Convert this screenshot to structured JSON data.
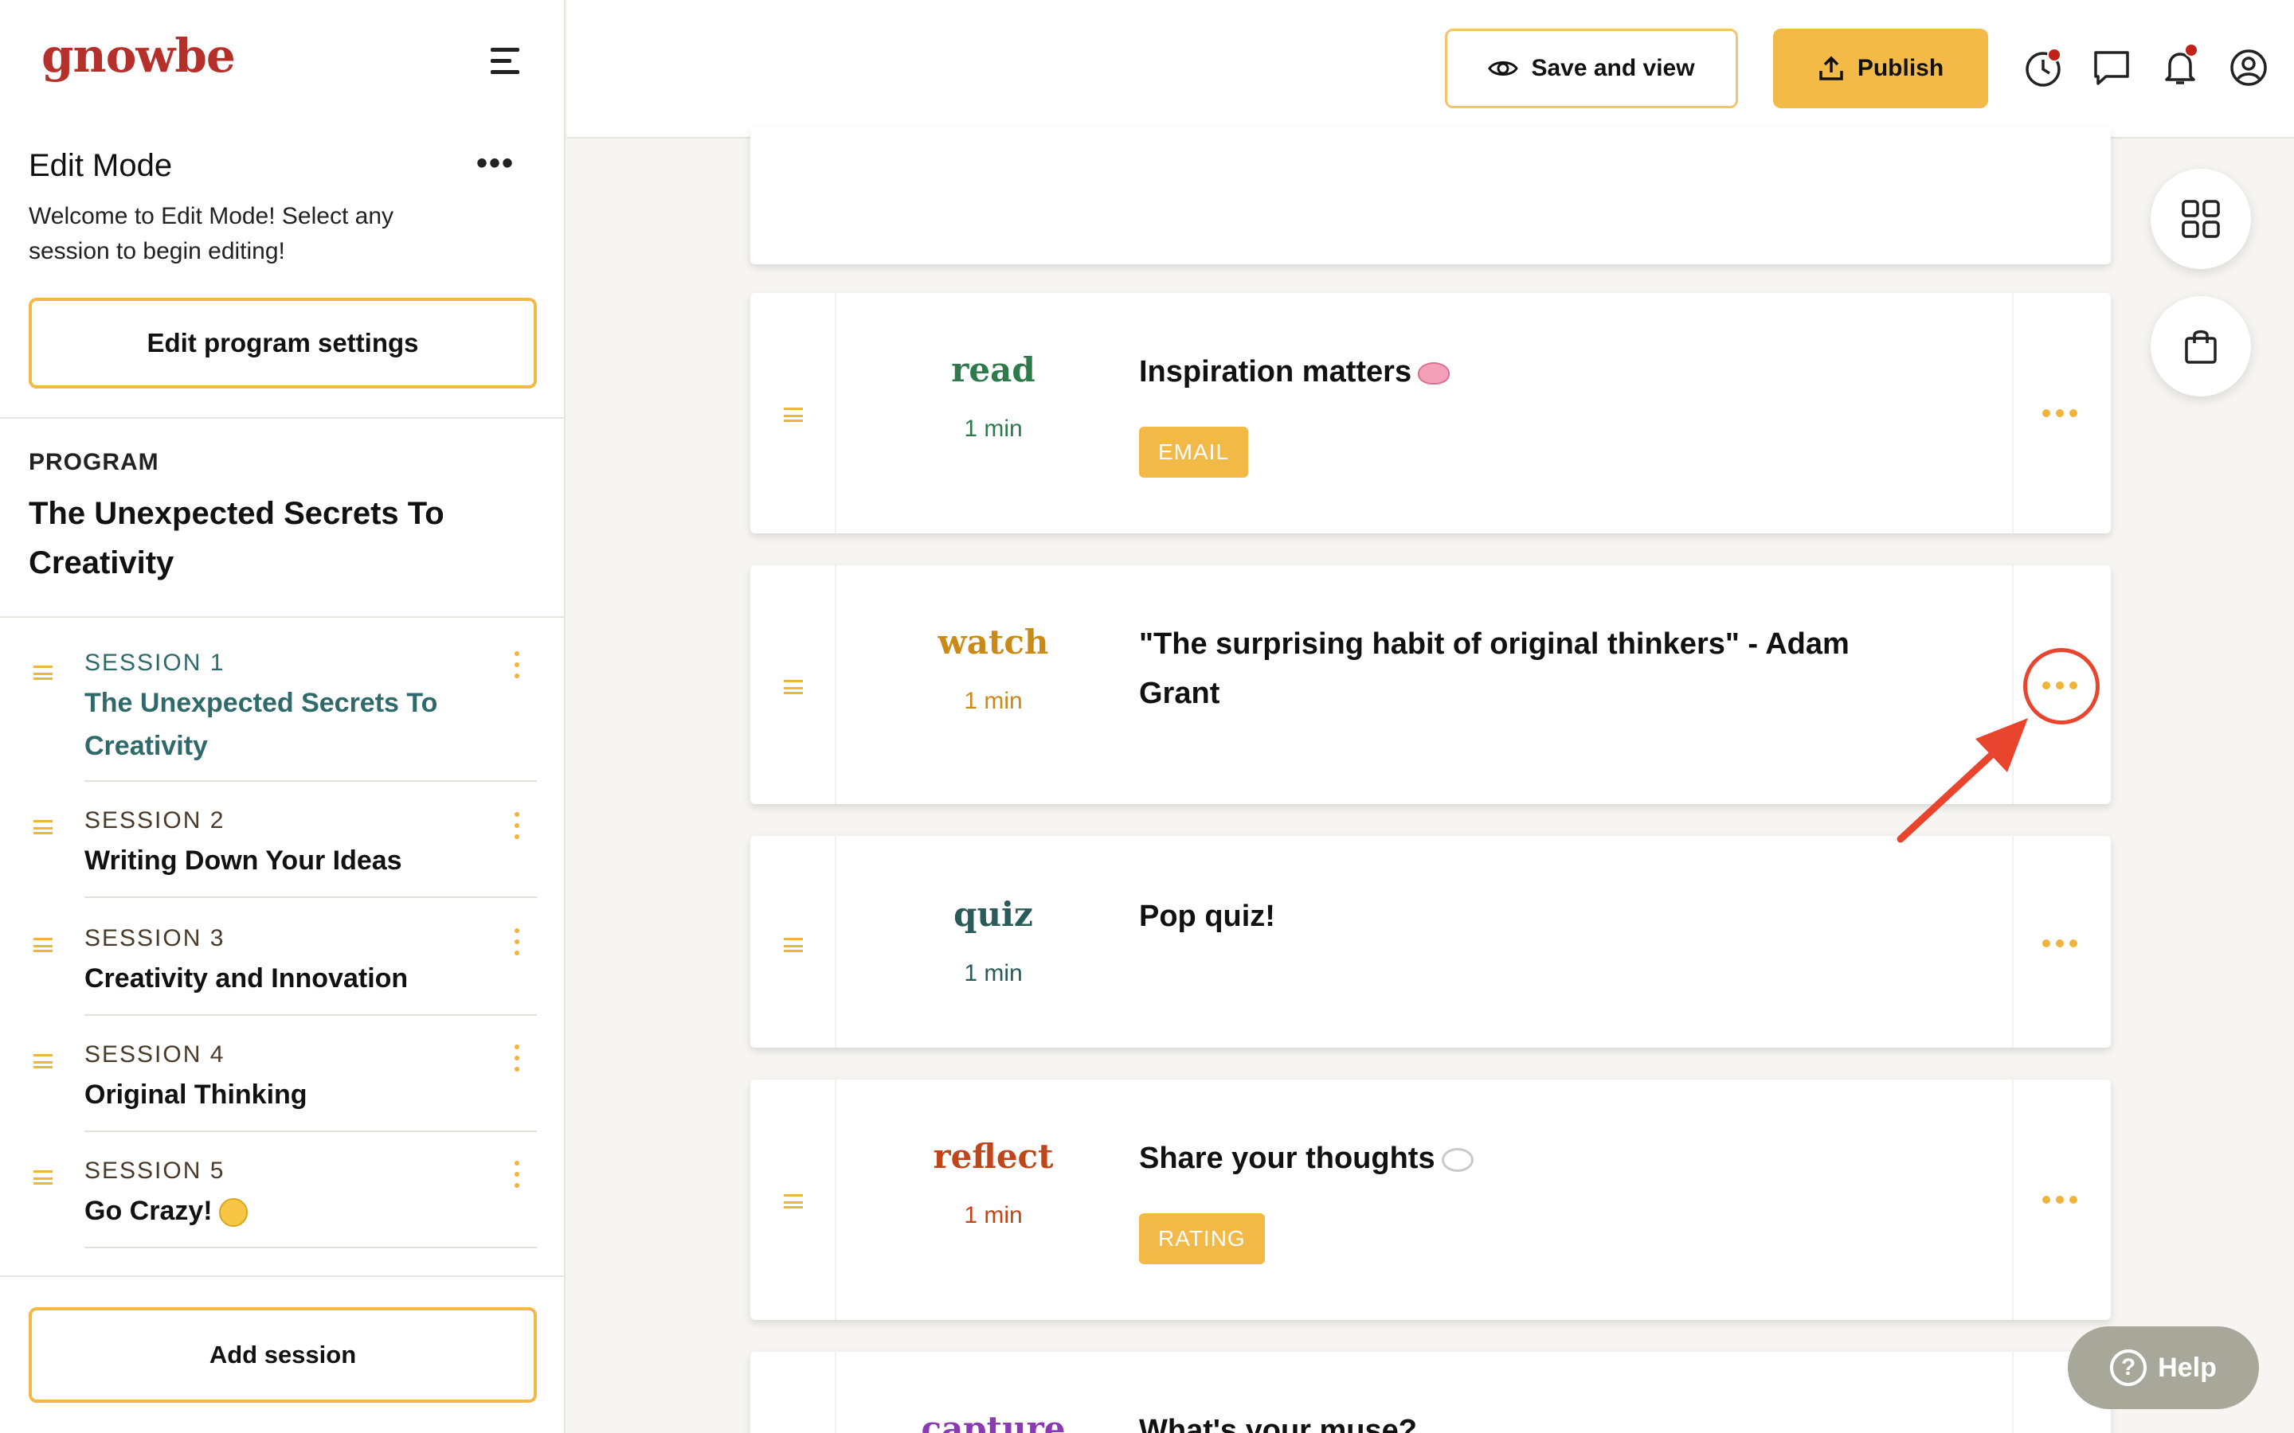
{
  "app": {
    "logo": "gnowbe"
  },
  "sidebar": {
    "edit_title": "Edit Mode",
    "edit_more": "•••",
    "edit_description": "Welcome to Edit Mode! Select any session to begin editing!",
    "edit_settings_label": "Edit program settings",
    "program_label": "PROGRAM",
    "program_title": "The Unexpected Secrets To Creativity",
    "sessions": [
      {
        "number": "SESSION 1",
        "title": "The Unexpected Secrets To Creativity",
        "active": true
      },
      {
        "number": "SESSION 2",
        "title": "Writing Down Your Ideas",
        "active": false
      },
      {
        "number": "SESSION 3",
        "title": "Creativity and Innovation",
        "active": false
      },
      {
        "number": "SESSION 4",
        "title": "Original Thinking",
        "active": false
      },
      {
        "number": "SESSION 5",
        "title": "Go Crazy!",
        "active": false
      }
    ],
    "add_session_label": "Add session"
  },
  "header": {
    "save_view_label": "Save and view",
    "publish_label": "Publish",
    "icons": [
      "history-icon",
      "chat-icon",
      "bell-icon",
      "account-icon"
    ]
  },
  "cards": [
    {
      "type": "read",
      "duration": "1 min",
      "title": "Inspiration matters",
      "badge": "EMAIL",
      "type_color": "#2e7a4a"
    },
    {
      "type": "watch",
      "duration": "1 min",
      "title": "\"The surprising habit of original thinkers\" - Adam Grant",
      "badge": "",
      "type_color": "#c98a18"
    },
    {
      "type": "quiz",
      "duration": "1 min",
      "title": "Pop quiz!",
      "badge": "",
      "type_color": "#2a5a5a"
    },
    {
      "type": "reflect",
      "duration": "1 min",
      "title": "Share your thoughts",
      "badge": "RATING",
      "type_color": "#c0461a"
    },
    {
      "type": "capture",
      "duration": "",
      "title": "What's your muse?",
      "badge": "",
      "type_color": "#8a3ab5"
    }
  ],
  "help": {
    "label": "Help"
  },
  "colors": {
    "accent": "#f4ba48",
    "brand": "#b5302a",
    "annotation": "#e8442e"
  }
}
